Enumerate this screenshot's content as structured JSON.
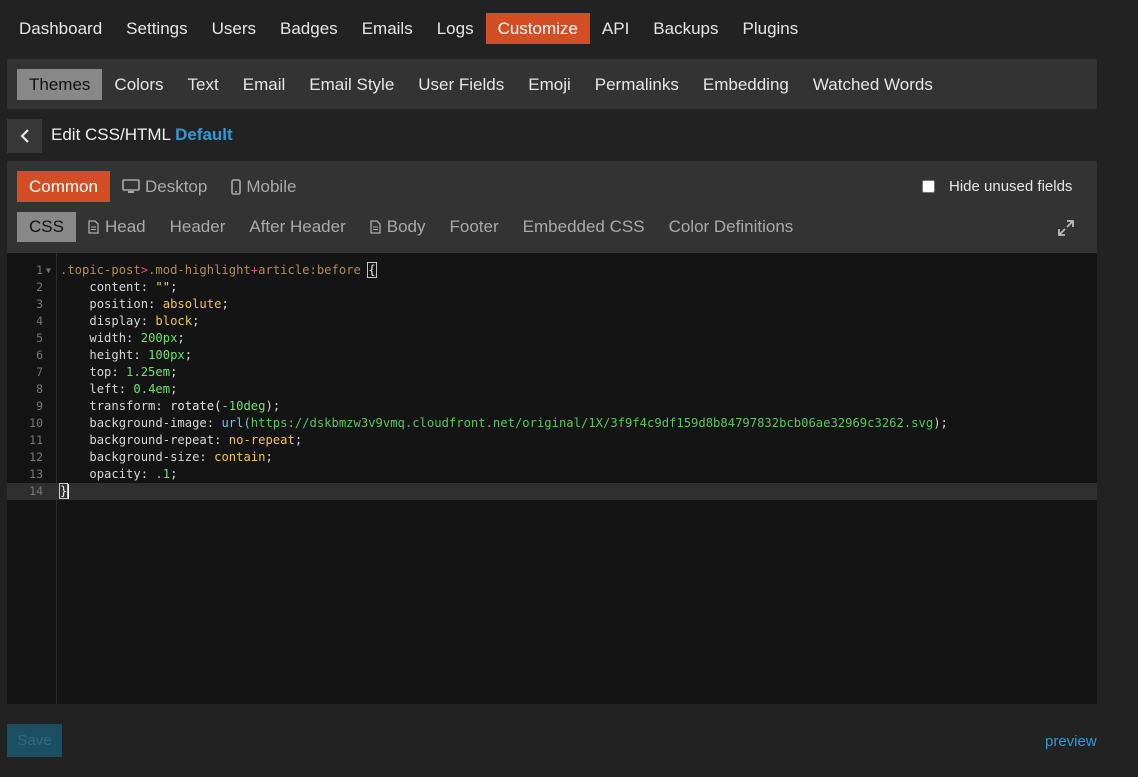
{
  "topnav": {
    "items": [
      {
        "label": "Dashboard"
      },
      {
        "label": "Settings"
      },
      {
        "label": "Users"
      },
      {
        "label": "Badges"
      },
      {
        "label": "Emails"
      },
      {
        "label": "Logs"
      },
      {
        "label": "Customize",
        "active": true
      },
      {
        "label": "API"
      },
      {
        "label": "Backups"
      },
      {
        "label": "Plugins"
      }
    ]
  },
  "subnav": {
    "items": [
      {
        "label": "Themes",
        "active": true
      },
      {
        "label": "Colors"
      },
      {
        "label": "Text"
      },
      {
        "label": "Email"
      },
      {
        "label": "Email Style"
      },
      {
        "label": "User Fields"
      },
      {
        "label": "Emoji"
      },
      {
        "label": "Permalinks"
      },
      {
        "label": "Embedding"
      },
      {
        "label": "Watched Words"
      }
    ]
  },
  "header": {
    "title": "Edit CSS/HTML",
    "theme_name": "Default"
  },
  "targets": {
    "common": "Common",
    "desktop": "Desktop",
    "mobile": "Mobile"
  },
  "hide_unused": {
    "label": "Hide unused fields",
    "checked": false
  },
  "fields": {
    "css": "CSS",
    "head": "Head",
    "header": "Header",
    "after_header": "After Header",
    "body": "Body",
    "footer": "Footer",
    "embedded_css": "Embedded CSS",
    "color_definitions": "Color Definitions"
  },
  "editor": {
    "line_numbers": [
      "1",
      "2",
      "3",
      "4",
      "5",
      "6",
      "7",
      "8",
      "9",
      "10",
      "11",
      "12",
      "13",
      "14"
    ],
    "code": {
      "sel1": ".topic-post",
      "op1": ">",
      "sel2": ".mod-highlight",
      "op2": "+",
      "sel3": "article:before",
      "brace_open": "{",
      "l2_prop": "content: ",
      "l2_val": "\"\"",
      "l3_prop": "position: ",
      "l3_val": "absolute",
      "l4_prop": "display: ",
      "l4_val": "block",
      "l5_prop": "width: ",
      "l5_val": "200px",
      "l6_prop": "height: ",
      "l6_val": "100px",
      "l7_prop": "top: ",
      "l7_val": "1.25em",
      "l8_prop": "left: ",
      "l8_val": "0.4em",
      "l9_prop": "transform: ",
      "l9_fn": "rotate(",
      "l9_val": "-10deg",
      "l10_prop": "background-image: ",
      "l10_fn": "url(",
      "l10_val": "https://dskbmzw3v9vmq.cloudfront.net/original/1X/3f9f4c9df159d8b84797832bcb06ae32969c3262.svg",
      "l11_prop": "background-repeat: ",
      "l11_val": "no-repeat",
      "l12_prop": "background-size: ",
      "l12_val": "contain",
      "l13_prop": "opacity: ",
      "l13_val": ".1",
      "brace_close": "}"
    }
  },
  "footer": {
    "save_label": "Save",
    "preview_label": "preview"
  },
  "colors": {
    "accent": "#d34d25",
    "link": "#2f9bd6",
    "save_disabled": "#1c4f62"
  }
}
